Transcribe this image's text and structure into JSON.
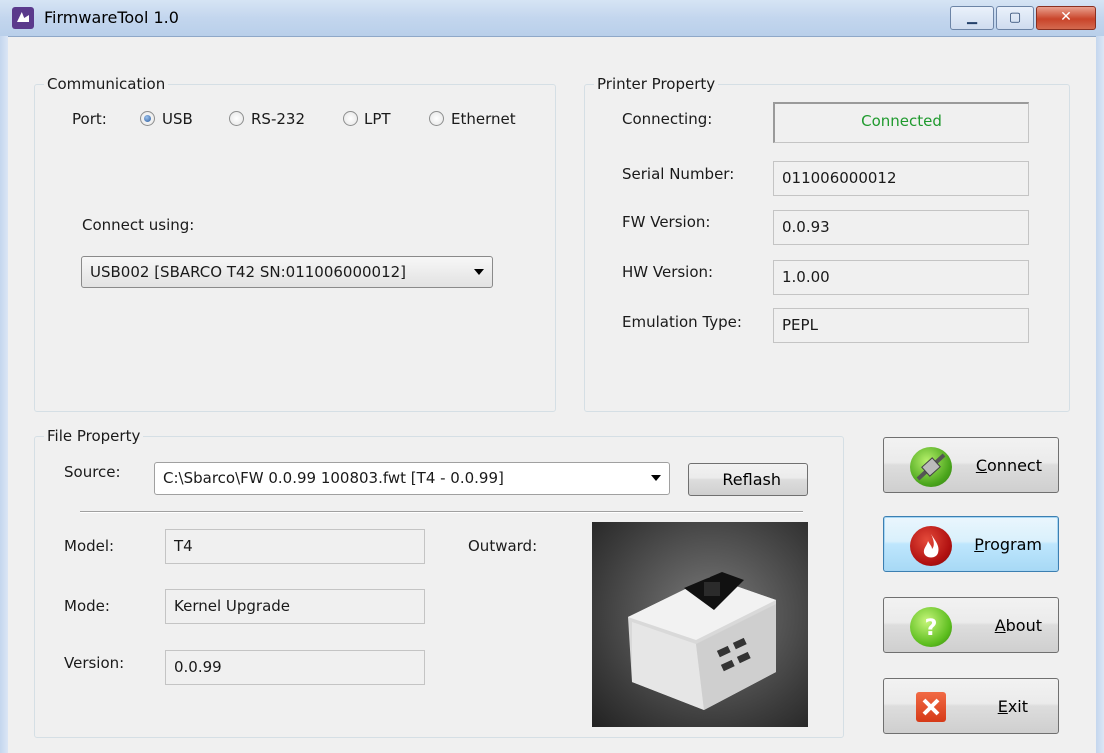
{
  "window": {
    "title": "FirmwareTool 1.0"
  },
  "communication": {
    "title": "Communication",
    "port_label": "Port:",
    "ports": [
      {
        "label": "USB",
        "selected": true
      },
      {
        "label": "RS-232",
        "selected": false
      },
      {
        "label": "LPT",
        "selected": false
      },
      {
        "label": "Ethernet",
        "selected": false
      }
    ],
    "connect_using_label": "Connect using:",
    "connect_using_value": "USB002 [SBARCO T42  SN:011006000012]"
  },
  "printer": {
    "title": "Printer Property",
    "connecting_label": "Connecting:",
    "connecting_value": "Connected",
    "connecting_color": "#1f9a2e",
    "serial_label": "Serial Number:",
    "serial_value": "011006000012",
    "fw_label": "FW Version:",
    "fw_value": "0.0.93",
    "hw_label": "HW Version:",
    "hw_value": "1.0.00",
    "emulation_label": "Emulation Type:",
    "emulation_value": "PEPL"
  },
  "file": {
    "title": "File Property",
    "source_label": "Source:",
    "source_value": "C:\\Sbarco\\FW 0.0.99 100803.fwt [T4 - 0.0.99]",
    "reflash_label": "Reflash",
    "model_label": "Model:",
    "model_value": "T4",
    "mode_label": "Mode:",
    "mode_value": "Kernel Upgrade",
    "version_label": "Version:",
    "version_value": "0.0.99",
    "outward_label": "Outward:"
  },
  "actions": {
    "connect": {
      "label": "Connect",
      "icon": "plug-icon"
    },
    "program": {
      "label": "Program",
      "icon": "flame-icon"
    },
    "about": {
      "label": "About",
      "icon": "question-icon"
    },
    "exit": {
      "label": "Exit",
      "icon": "close-x-icon"
    }
  }
}
